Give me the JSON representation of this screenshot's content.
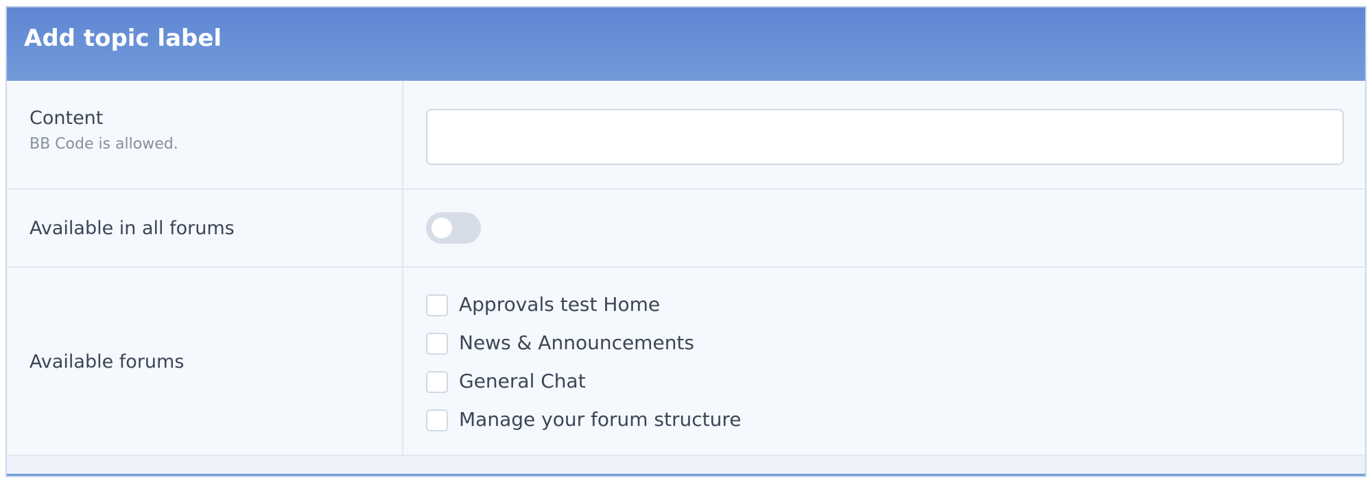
{
  "panel": {
    "title": "Add topic label"
  },
  "content": {
    "label": "Content",
    "hint": "BB Code is allowed.",
    "value": "",
    "placeholder": ""
  },
  "all_forums": {
    "label": "Available in all forums",
    "enabled": false
  },
  "available_forums": {
    "label": "Available forums",
    "items": [
      {
        "label": "Approvals test Home",
        "checked": false
      },
      {
        "label": "News & Announcements",
        "checked": false
      },
      {
        "label": "General Chat",
        "checked": false
      },
      {
        "label": "Manage your forum structure",
        "checked": false
      }
    ]
  },
  "colors": {
    "header_start": "#5f86d2",
    "header_end": "#729bdb",
    "panel_bg": "#f5f8fc",
    "text": "#3a4657",
    "hint_text": "#868f9c",
    "toggle_off": "#d6dde7"
  }
}
